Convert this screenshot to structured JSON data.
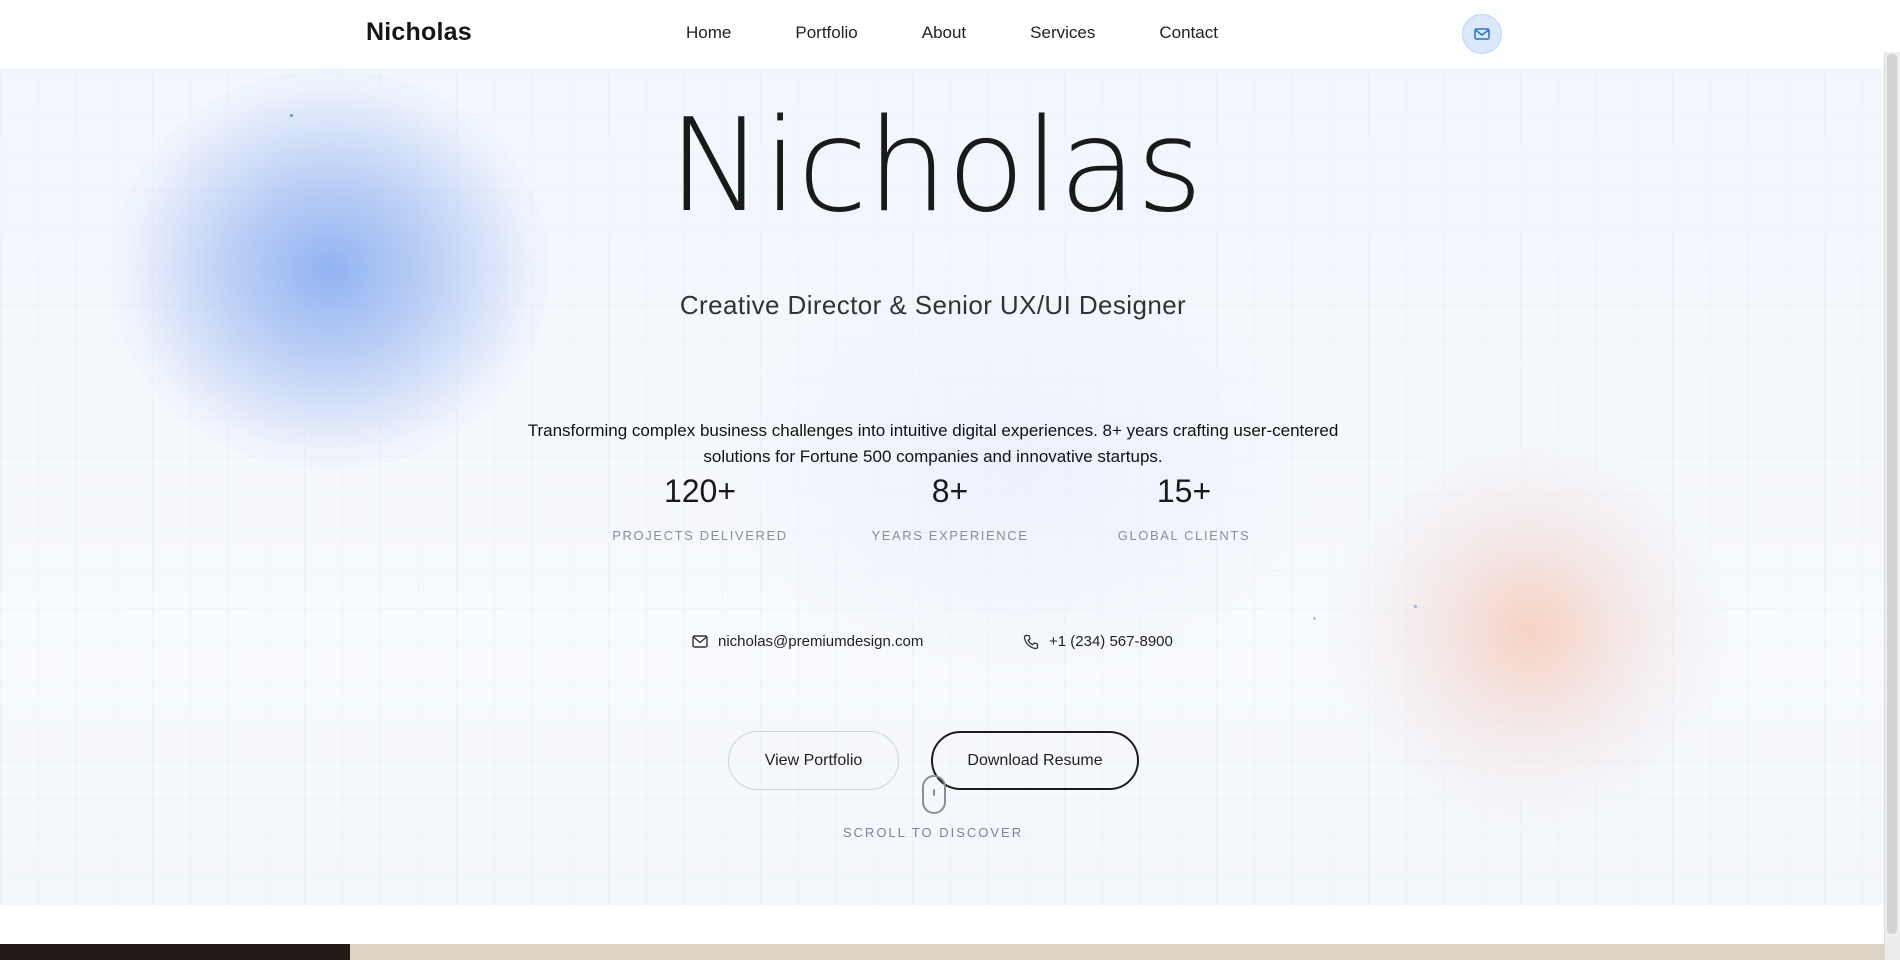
{
  "nav": {
    "logo": "Nicholas",
    "links": [
      "Home",
      "Portfolio",
      "About",
      "Services",
      "Contact"
    ],
    "mail_icon": "mail-icon"
  },
  "hero": {
    "name": "Nicholas",
    "subtitle": "Creative Director & Senior UX/UI Designer",
    "description": "Transforming complex business challenges into intuitive digital experiences. 8+ years crafting user-centered solutions for Fortune 500 companies and innovative startups."
  },
  "stats": [
    {
      "value": "120+",
      "label": "PROJECTS DELIVERED"
    },
    {
      "value": "8+",
      "label": "YEARS EXPERIENCE"
    },
    {
      "value": "15+",
      "label": "GLOBAL CLIENTS"
    }
  ],
  "contact": {
    "email": "nicholas@premiumdesign.com",
    "phone": "+1 (234) 567-8900",
    "email_icon": "mail-icon",
    "phone_icon": "phone-icon"
  },
  "buttons": {
    "view_portfolio": "View Portfolio",
    "download_resume": "Download Resume"
  },
  "scroll_hint": "SCROLL TO DISCOVER",
  "colors": {
    "accent_blue": "#80a7f0",
    "accent_peach": "#f6c8b4",
    "text_dark": "#1a1a1a",
    "footer_dark": "#221a16",
    "footer_tan": "#ddd3c2"
  }
}
